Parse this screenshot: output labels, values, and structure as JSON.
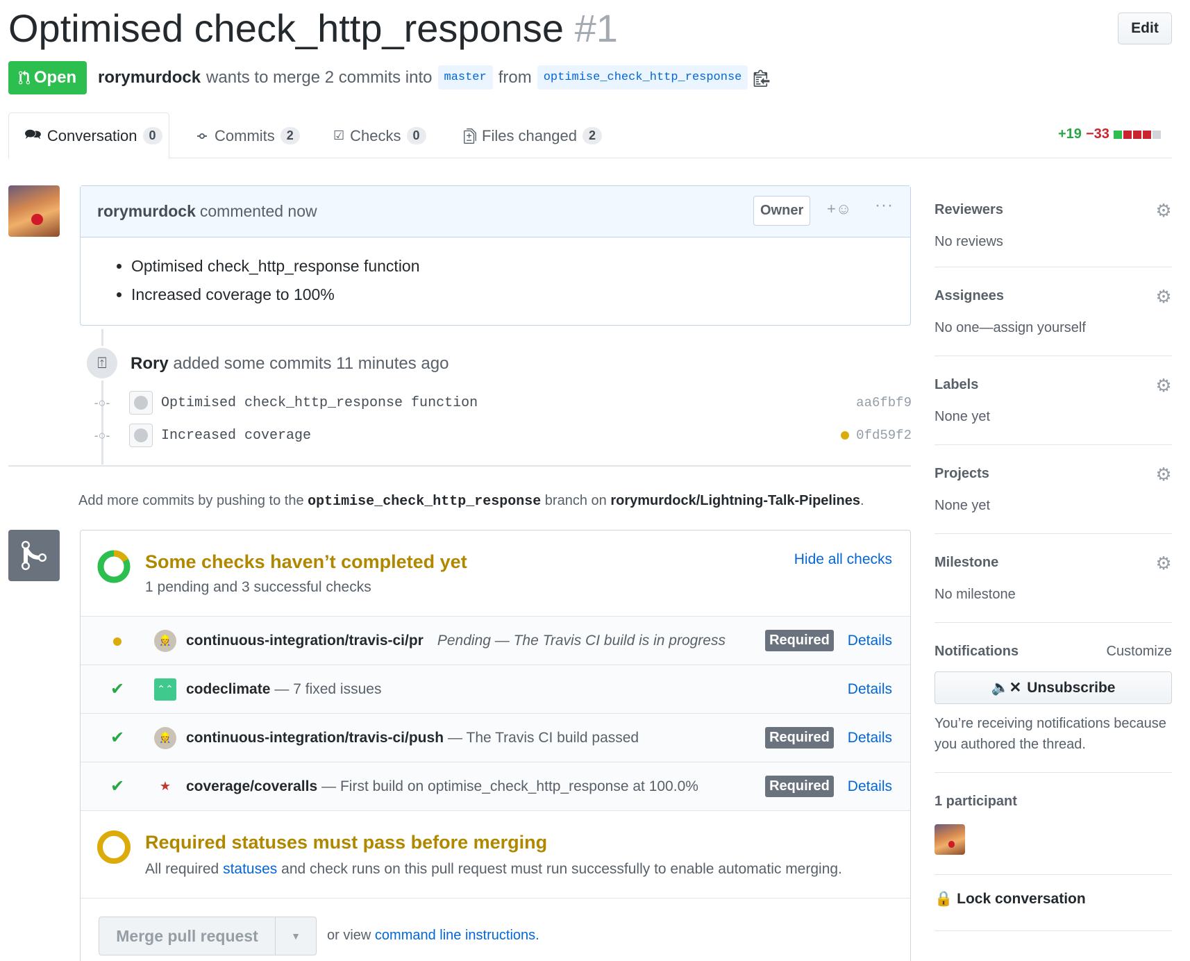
{
  "pr": {
    "title": "Optimised check_http_response",
    "number": "#1",
    "edit_label": "Edit",
    "state": "Open",
    "author": "rorymurdock",
    "merge_text": "wants to merge 2 commits into",
    "base_branch": "master",
    "from_text": "from",
    "head_branch": "optimise_check_http_response"
  },
  "tabs": [
    {
      "label": "Conversation",
      "count": "0",
      "icon": "comment-discussion-icon"
    },
    {
      "label": "Commits",
      "count": "2",
      "icon": "git-commit-icon"
    },
    {
      "label": "Checks",
      "count": "0",
      "icon": "checklist-icon"
    },
    {
      "label": "Files changed",
      "count": "2",
      "icon": "file-diff-icon"
    }
  ],
  "diffstat": {
    "additions": "+19",
    "deletions": "−33",
    "blocks": [
      "#2cbe4e",
      "#cb2431",
      "#cb2431",
      "#cb2431",
      "#d1d5da"
    ]
  },
  "comment": {
    "author": "rorymurdock",
    "action": "commented now",
    "badge": "Owner",
    "bullets": [
      "Optimised check_http_response function",
      "Increased coverage to 100%"
    ]
  },
  "push_event": {
    "actor": "Rory",
    "text": "added some commits 11 minutes ago",
    "commits": [
      {
        "message": "Optimised check_http_response function",
        "sha": "aa6fbf9",
        "status": ""
      },
      {
        "message": "Increased coverage",
        "sha": "0fd59f2",
        "status": "pending"
      }
    ]
  },
  "hint": {
    "prefix": "Add more commits by pushing to the",
    "branch": "optimise_check_http_response",
    "middle": "branch on",
    "repo": "rorymurdock/Lightning-Talk-Pipelines",
    "suffix": "."
  },
  "checks": {
    "title": "Some checks haven’t completed yet",
    "summary": "1 pending and 3 successful checks",
    "hide_label": "Hide all checks",
    "items": [
      {
        "status": "pending",
        "context": "continuous-integration/travis-ci/pr",
        "description": "Pending — The Travis CI build is in progress",
        "required": "Required",
        "details": "Details"
      },
      {
        "status": "success",
        "context": "codeclimate",
        "description": "— 7 fixed issues",
        "required": "",
        "details": "Details"
      },
      {
        "status": "success",
        "context": "continuous-integration/travis-ci/push",
        "description": "— The Travis CI build passed",
        "required": "Required",
        "details": "Details"
      },
      {
        "status": "success",
        "context": "coverage/coveralls",
        "description": "— First build on optimise_check_http_response at 100.0%",
        "required": "Required",
        "details": "Details"
      }
    ]
  },
  "required_statuses": {
    "title": "Required statuses must pass before merging",
    "text_before": "All required",
    "link": "statuses",
    "text_after": "and check runs on this pull request must run successfully to enable automatic merging."
  },
  "merge": {
    "button_label": "Merge pull request",
    "or_view": "or view",
    "cli_link": "command line instructions."
  },
  "sidebar": {
    "reviewers": {
      "heading": "Reviewers",
      "value": "No reviews"
    },
    "assignees": {
      "heading": "Assignees",
      "value": "No one—assign yourself"
    },
    "labels": {
      "heading": "Labels",
      "value": "None yet"
    },
    "projects": {
      "heading": "Projects",
      "value": "None yet"
    },
    "milestone": {
      "heading": "Milestone",
      "value": "No milestone"
    },
    "notifications": {
      "heading": "Notifications",
      "customize": "Customize",
      "unsubscribe": "Unsubscribe",
      "reason": "You’re receiving notifications because you authored the thread."
    },
    "participants": {
      "heading": "1 participant"
    },
    "lock": "Lock conversation"
  },
  "colors": {
    "open_green": "#2cbe4e",
    "link_blue": "#0366d6",
    "pending_yellow": "#dbab09",
    "success_green": "#28a745"
  }
}
